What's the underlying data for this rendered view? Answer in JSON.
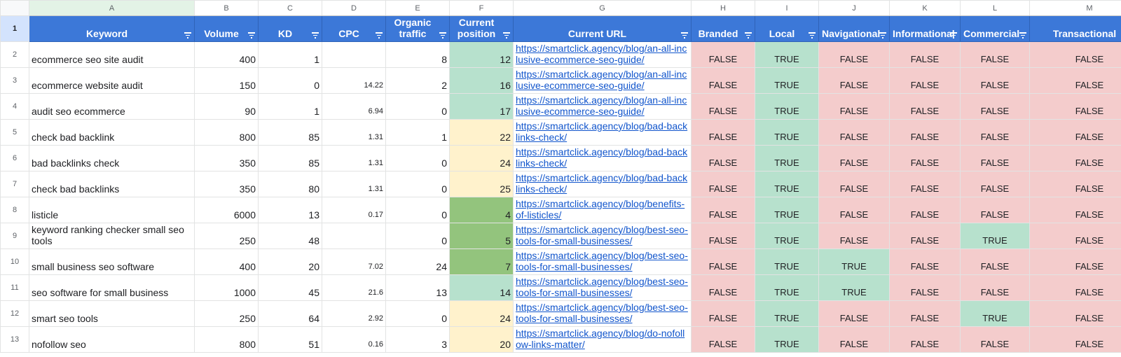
{
  "columns": [
    "A",
    "B",
    "C",
    "D",
    "E",
    "F",
    "G",
    "H",
    "I",
    "J",
    "K",
    "L",
    "M"
  ],
  "selected_column": "A",
  "headers": {
    "row_number": "1",
    "labels": [
      "Keyword",
      "Volume",
      "KD",
      "CPC",
      "Organic traffic",
      "Current position",
      "Current URL",
      "Branded",
      "Local",
      "Navigational",
      "Informational",
      "Commercial",
      "Transactional"
    ]
  },
  "colors": {
    "header_bg": "#3c78d8",
    "false_bg": "#f4cccc",
    "true_bg": "#b7e1cd",
    "pos_dark_green": "#93c47d",
    "pos_light_green": "#b7e1cd",
    "pos_yellow": "#fff2cc",
    "link": "#1155cc"
  },
  "rows": [
    {
      "n": "2",
      "keyword": "ecommerce seo site audit",
      "volume": "400",
      "kd": "1",
      "cpc": "",
      "traffic": "8",
      "position": "12",
      "pos_tier": "light",
      "url": "https://smartclick.agency/blog/an-all-inclusive-ecommerce-seo-guide/",
      "branded": "FALSE",
      "local": "TRUE",
      "navigational": "FALSE",
      "informational": "FALSE",
      "commercial": "FALSE",
      "transactional": "FALSE"
    },
    {
      "n": "3",
      "keyword": "ecommerce website audit",
      "volume": "150",
      "kd": "0",
      "cpc": "14.22",
      "traffic": "2",
      "position": "16",
      "pos_tier": "light",
      "url": "https://smartclick.agency/blog/an-all-inclusive-ecommerce-seo-guide/",
      "branded": "FALSE",
      "local": "TRUE",
      "navigational": "FALSE",
      "informational": "FALSE",
      "commercial": "FALSE",
      "transactional": "FALSE"
    },
    {
      "n": "4",
      "keyword": "audit seo ecommerce",
      "volume": "90",
      "kd": "1",
      "cpc": "6.94",
      "traffic": "0",
      "position": "17",
      "pos_tier": "light",
      "url": "https://smartclick.agency/blog/an-all-inclusive-ecommerce-seo-guide/",
      "branded": "FALSE",
      "local": "TRUE",
      "navigational": "FALSE",
      "informational": "FALSE",
      "commercial": "FALSE",
      "transactional": "FALSE"
    },
    {
      "n": "5",
      "keyword": "check bad backlink",
      "volume": "800",
      "kd": "85",
      "cpc": "1.31",
      "traffic": "1",
      "position": "22",
      "pos_tier": "yellow",
      "url": "https://smartclick.agency/blog/bad-backlinks-check/",
      "branded": "FALSE",
      "local": "TRUE",
      "navigational": "FALSE",
      "informational": "FALSE",
      "commercial": "FALSE",
      "transactional": "FALSE"
    },
    {
      "n": "6",
      "keyword": "bad backlinks check",
      "volume": "350",
      "kd": "85",
      "cpc": "1.31",
      "traffic": "0",
      "position": "24",
      "pos_tier": "yellow",
      "url": "https://smartclick.agency/blog/bad-backlinks-check/",
      "branded": "FALSE",
      "local": "TRUE",
      "navigational": "FALSE",
      "informational": "FALSE",
      "commercial": "FALSE",
      "transactional": "FALSE"
    },
    {
      "n": "7",
      "keyword": "check bad backlinks",
      "volume": "350",
      "kd": "80",
      "cpc": "1.31",
      "traffic": "0",
      "position": "25",
      "pos_tier": "yellow",
      "url": "https://smartclick.agency/blog/bad-backlinks-check/",
      "branded": "FALSE",
      "local": "TRUE",
      "navigational": "FALSE",
      "informational": "FALSE",
      "commercial": "FALSE",
      "transactional": "FALSE"
    },
    {
      "n": "8",
      "keyword": "listicle",
      "volume": "6000",
      "kd": "13",
      "cpc": "0.17",
      "traffic": "0",
      "position": "4",
      "pos_tier": "dark",
      "url": "https://smartclick.agency/blog/benefits-of-listicles/",
      "branded": "FALSE",
      "local": "TRUE",
      "navigational": "FALSE",
      "informational": "FALSE",
      "commercial": "FALSE",
      "transactional": "FALSE"
    },
    {
      "n": "9",
      "keyword": "keyword ranking checker small seo tools",
      "volume": "250",
      "kd": "48",
      "cpc": "",
      "traffic": "0",
      "position": "5",
      "pos_tier": "dark",
      "url": "https://smartclick.agency/blog/best-seo-tools-for-small-businesses/",
      "branded": "FALSE",
      "local": "TRUE",
      "navigational": "FALSE",
      "informational": "FALSE",
      "commercial": "TRUE",
      "transactional": "FALSE"
    },
    {
      "n": "10",
      "keyword": "small business seo software",
      "volume": "400",
      "kd": "20",
      "cpc": "7.02",
      "traffic": "24",
      "position": "7",
      "pos_tier": "dark",
      "url": "https://smartclick.agency/blog/best-seo-tools-for-small-businesses/",
      "branded": "FALSE",
      "local": "TRUE",
      "navigational": "TRUE",
      "informational": "FALSE",
      "commercial": "FALSE",
      "transactional": "FALSE"
    },
    {
      "n": "11",
      "keyword": "seo software for small business",
      "volume": "1000",
      "kd": "45",
      "cpc": "21.6",
      "traffic": "13",
      "position": "14",
      "pos_tier": "light",
      "url": "https://smartclick.agency/blog/best-seo-tools-for-small-businesses/",
      "branded": "FALSE",
      "local": "TRUE",
      "navigational": "TRUE",
      "informational": "FALSE",
      "commercial": "FALSE",
      "transactional": "FALSE"
    },
    {
      "n": "12",
      "keyword": "smart seo tools",
      "volume": "250",
      "kd": "64",
      "cpc": "2.92",
      "traffic": "0",
      "position": "24",
      "pos_tier": "yellow",
      "url": "https://smartclick.agency/blog/best-seo-tools-for-small-businesses/",
      "branded": "FALSE",
      "local": "TRUE",
      "navigational": "FALSE",
      "informational": "FALSE",
      "commercial": "TRUE",
      "transactional": "FALSE"
    },
    {
      "n": "13",
      "keyword": "nofollow seo",
      "volume": "800",
      "kd": "51",
      "cpc": "0.16",
      "traffic": "3",
      "position": "20",
      "pos_tier": "yellow",
      "url": "https://smartclick.agency/blog/do-nofollow-links-matter/",
      "branded": "FALSE",
      "local": "TRUE",
      "navigational": "FALSE",
      "informational": "FALSE",
      "commercial": "FALSE",
      "transactional": "FALSE"
    }
  ]
}
